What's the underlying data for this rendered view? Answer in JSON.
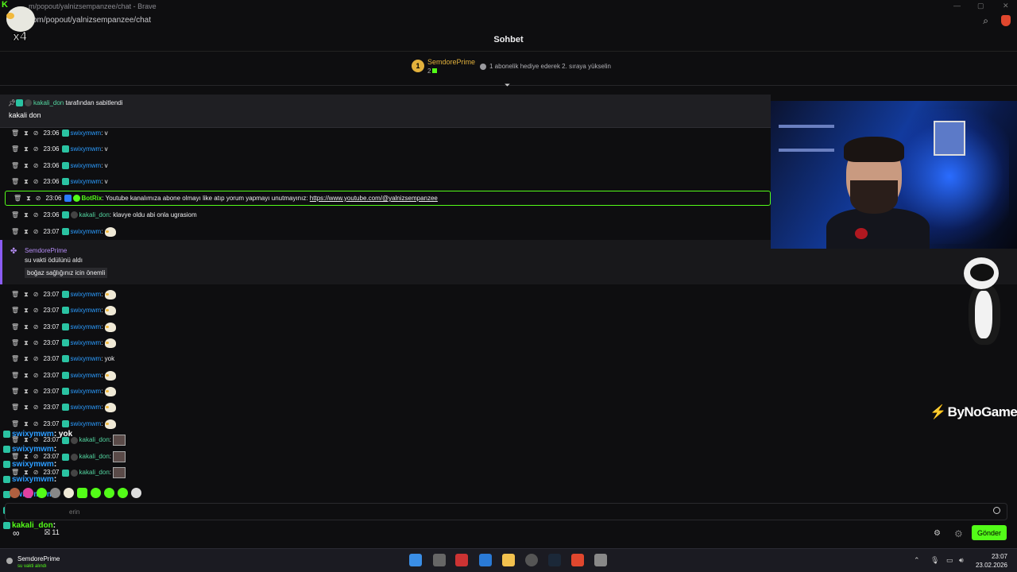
{
  "browser": {
    "title": "m/popout/yalnizsempanzee/chat - Brave",
    "url": "com/popout/yalnizsempanzee/chat"
  },
  "logo": {
    "badge": "x4"
  },
  "chat_header": "Sohbet",
  "top_gifter": {
    "rank": "1",
    "name": "SemdorePrime",
    "count": "2",
    "gift_hint": "1 abonelik hediye ederek 2. sıraya yükselin"
  },
  "pinned": {
    "user": "kakali_don",
    "by_suffix": "tarafından sabitlendi",
    "message": "kakali don"
  },
  "messages_a": [
    {
      "time": "23:06",
      "user": "swixymwm",
      "sep": ":",
      "text": "v"
    },
    {
      "time": "23:06",
      "user": "swixymwm",
      "sep": ":",
      "text": "v"
    },
    {
      "time": "23:06",
      "user": "swixymwm",
      "sep": ":",
      "text": "v"
    },
    {
      "time": "23:06",
      "user": "swixymwm",
      "sep": ":",
      "text": "v"
    }
  ],
  "bot_message": {
    "time": "23:06",
    "user": "BotRix",
    "text": "Youtube kanalımıza abone olmayı like atıp yorum yapmayı unutmayınız:",
    "link": "https://www.youtube.com/@yalnizsempanzee"
  },
  "message_kakali": {
    "time": "23:06",
    "user": "kakali_don",
    "sep": ":",
    "text": "klavye oldu abi onla ugrasiom"
  },
  "message_swixy_emote": {
    "time": "23:07",
    "user": "swixymwm",
    "sep": ":"
  },
  "reward": {
    "user": "SemdorePrime",
    "text": "su vakti ödülünü aldı",
    "message": "boğaz sağlığınız icin önemli"
  },
  "messages_b": [
    {
      "time": "23:07",
      "user": "swixymwm",
      "sep": ":",
      "text": ""
    },
    {
      "time": "23:07",
      "user": "swixymwm",
      "sep": ":",
      "text": ""
    },
    {
      "time": "23:07",
      "user": "swixymwm",
      "sep": ":",
      "text": ""
    },
    {
      "time": "23:07",
      "user": "swixymwm",
      "sep": ":",
      "text": ""
    },
    {
      "time": "23:07",
      "user": "swixymwm",
      "sep": ":",
      "text": "yok"
    },
    {
      "time": "23:07",
      "user": "swixymwm",
      "sep": ":",
      "text": ""
    },
    {
      "time": "23:07",
      "user": "swixymwm",
      "sep": ":",
      "text": ""
    },
    {
      "time": "23:07",
      "user": "swixymwm",
      "sep": ":",
      "text": ""
    },
    {
      "time": "23:07",
      "user": "swixymwm",
      "sep": ":",
      "text": ""
    },
    {
      "time": "23:07",
      "user": "kakali_don",
      "sep": ":",
      "text": ""
    },
    {
      "time": "23:07",
      "user": "kakali_don",
      "sep": ":",
      "text": ""
    },
    {
      "time": "23:07",
      "user": "kakali_don",
      "sep": ":",
      "text": ""
    }
  ],
  "overlay": [
    {
      "user": "swixymwm",
      "text": ": yok"
    },
    {
      "user": "swixymwm",
      "text": ":"
    },
    {
      "user": "swixymwm",
      "text": ":"
    },
    {
      "user": "swixymwm",
      "text": ":"
    },
    {
      "user": "swixymwm",
      "text": ""
    },
    {
      "user": "kakali_don",
      "text": ":"
    },
    {
      "user": "kakali_don",
      "text": ":"
    }
  ],
  "brand": "ByNoGame",
  "input": {
    "placeholder": "erin"
  },
  "bottom": {
    "infinity": "∞",
    "gift_count": "11",
    "send_label": "Gönder"
  },
  "taskbar": {
    "user": "SemdorePrime",
    "status": "su vakti alındı",
    "time": "23:07",
    "date": "23.02.2026"
  },
  "colors": {
    "kick_green": "#53fc18",
    "username_blue": "#2b9cff",
    "username_teal": "#53d6a0",
    "reward_purple": "#8b5cf6"
  }
}
